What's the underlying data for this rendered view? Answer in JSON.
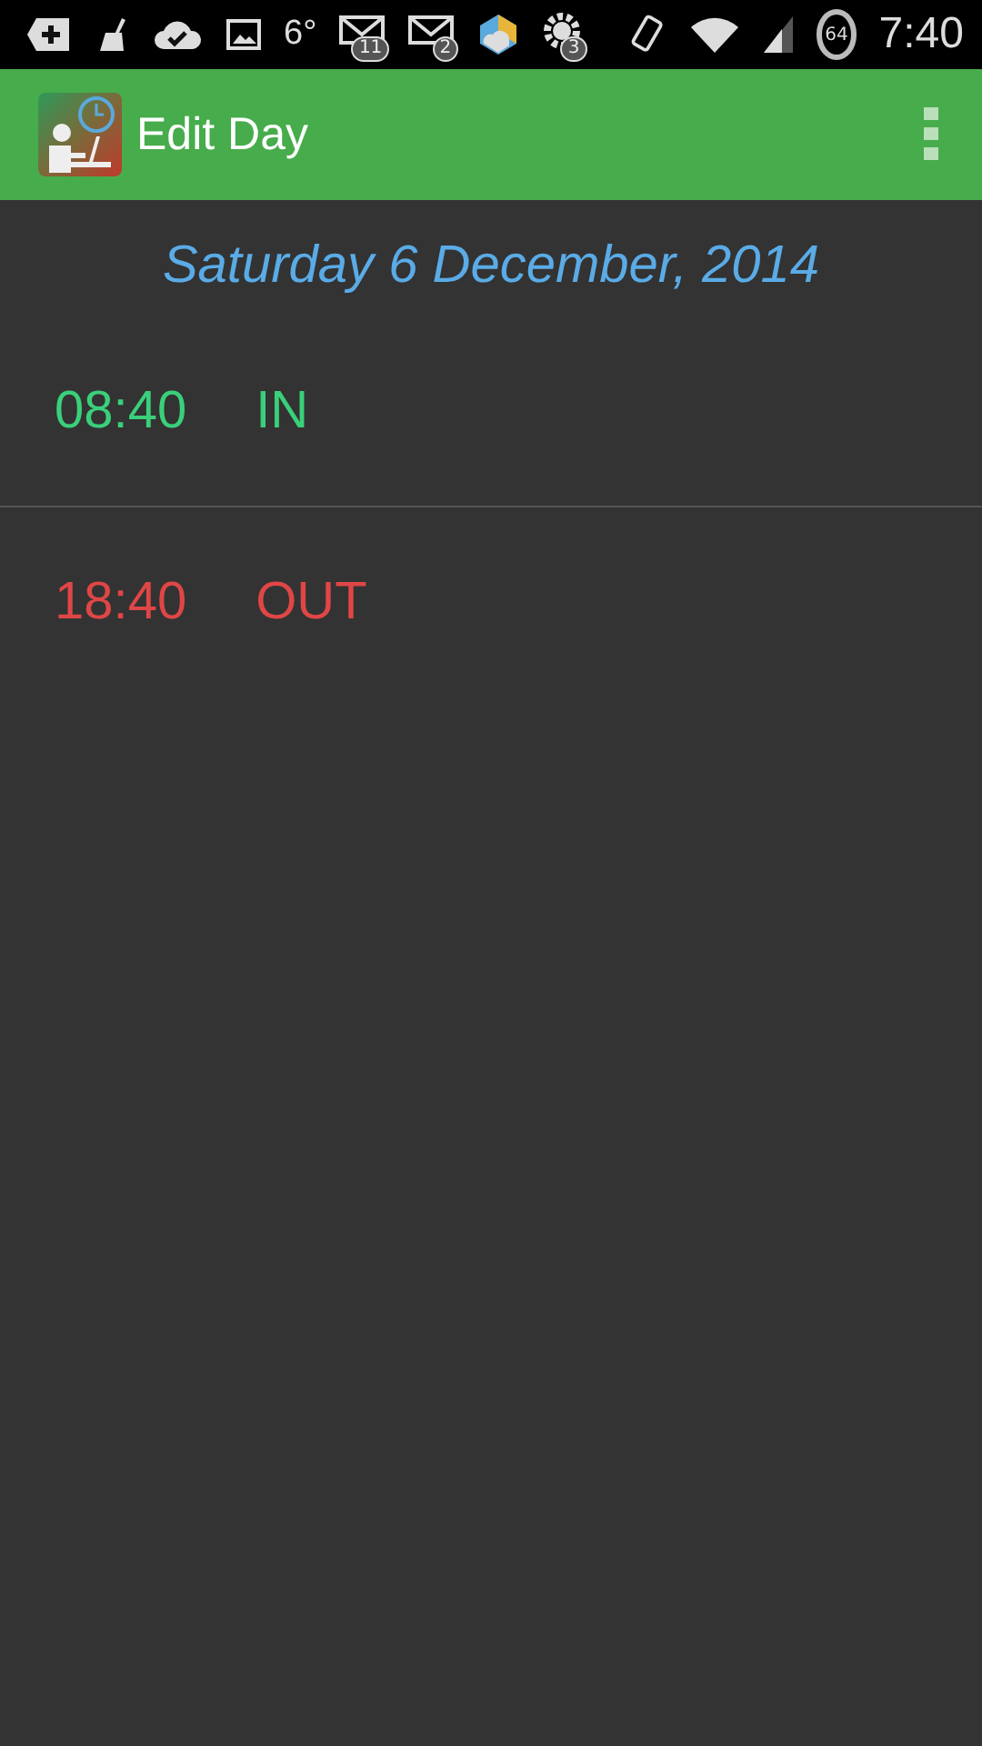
{
  "status_bar": {
    "temperature": "6°",
    "notifications": [
      {
        "kind": "mail",
        "count": "11"
      },
      {
        "kind": "mail",
        "count": "2"
      },
      {
        "kind": "settings",
        "count": "3"
      }
    ],
    "battery": "64",
    "time": "7:40"
  },
  "app_bar": {
    "title": "Edit Day"
  },
  "date": "Saturday 6 December, 2014",
  "entries": [
    {
      "time": "08:40",
      "label": "IN",
      "kind": "in"
    },
    {
      "time": "18:40",
      "label": "OUT",
      "kind": "out"
    }
  ]
}
